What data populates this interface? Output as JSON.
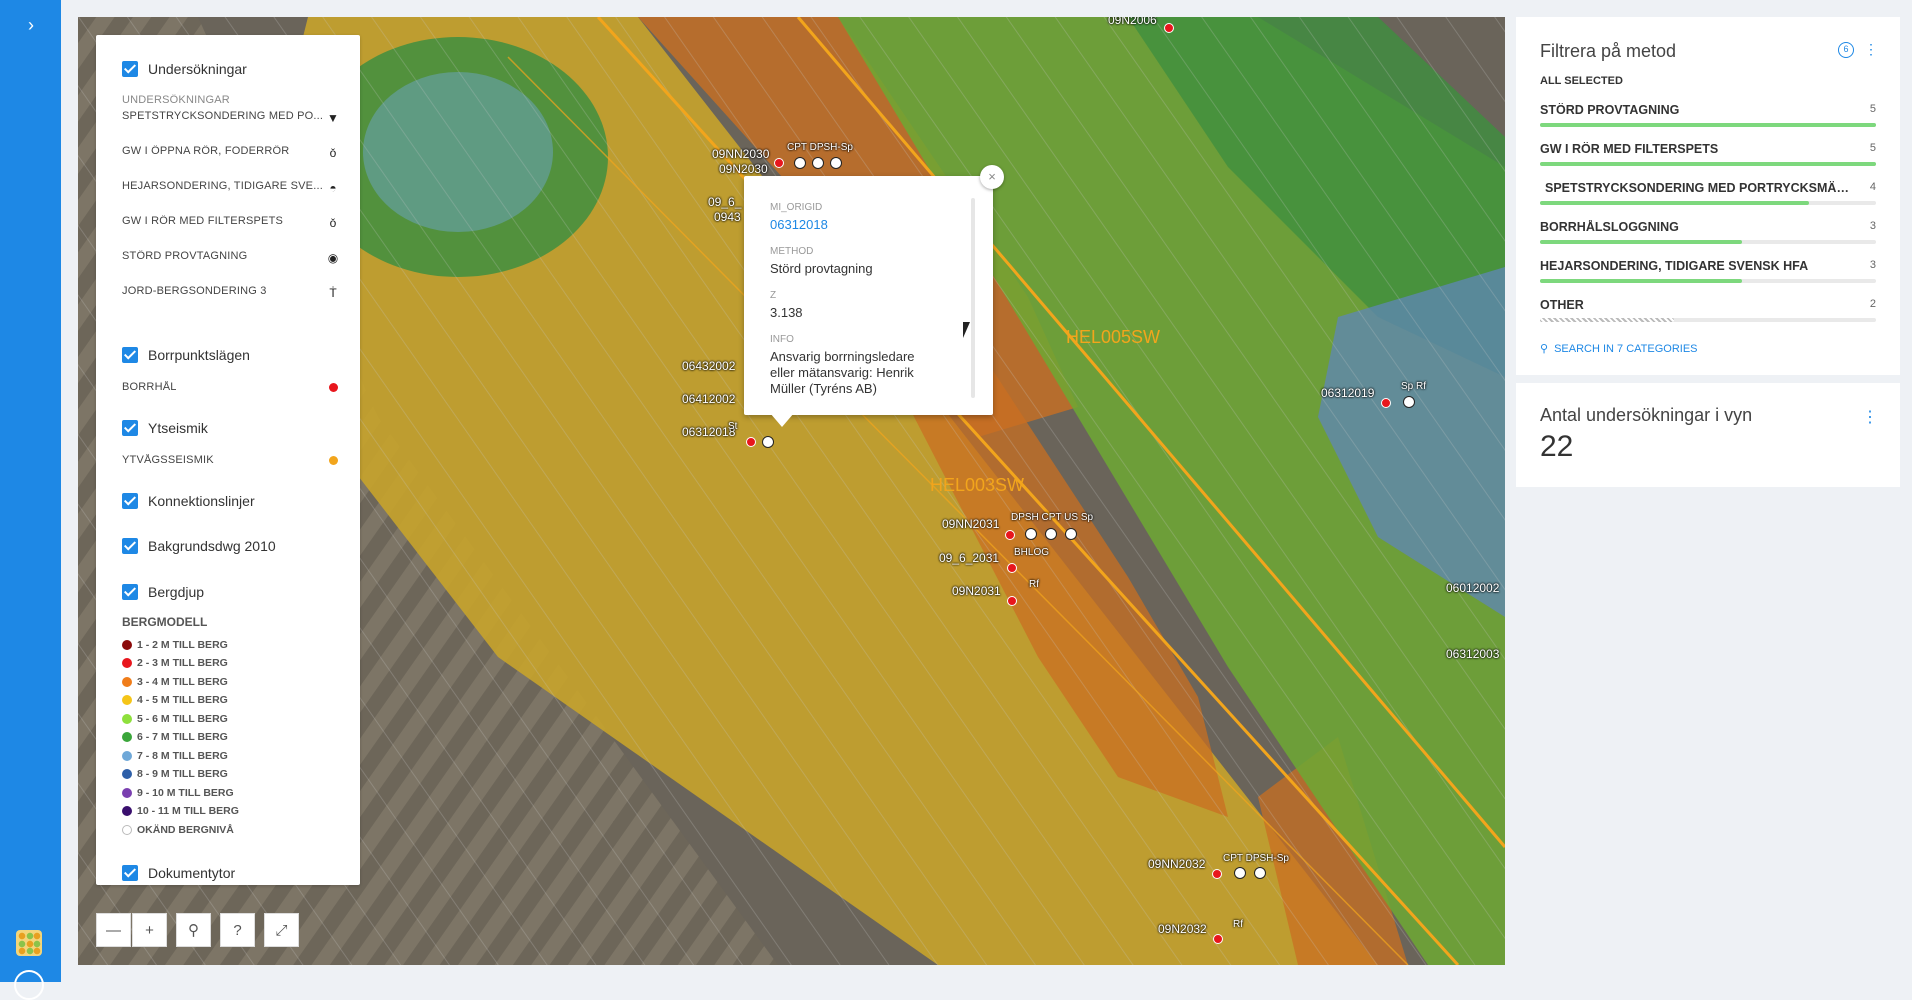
{
  "sidebar": {
    "expand_icon": "chevron-right-icon",
    "app_icon": "app-grid-icon"
  },
  "layers": {
    "undersokningar": {
      "label": "Undersökningar",
      "caption": "UNDERSÖKNINGAR",
      "items": [
        {
          "label": "SPETSTRYCKSONDERING MED PO...",
          "icon": "method-spets-icon"
        },
        {
          "label": "GW I ÖPPNA RÖR, FODERRÖR",
          "icon": "method-gw-open-icon"
        },
        {
          "label": "HEJARSONDERING, TIDIGARE SVE...",
          "icon": "method-hejar-icon"
        },
        {
          "label": "GW I RÖR MED FILTERSPETS",
          "icon": "method-gw-filter-icon"
        },
        {
          "label": "STÖRD PROVTAGNING",
          "icon": "method-stord-icon"
        },
        {
          "label": "JORD-BERGSONDERING 3",
          "icon": "method-jordberg-icon"
        }
      ]
    },
    "borrpunkt": {
      "label": "Borrpunktslägen",
      "items": [
        {
          "label": "BORRHÅL",
          "color": "#e8161d"
        }
      ]
    },
    "ytseismik": {
      "label": "Ytseismik",
      "items": [
        {
          "label": "YTVÅGSSEISMIK",
          "color": "#f2a51c"
        }
      ]
    },
    "konnektion": {
      "label": "Konnektionslinjer"
    },
    "bakgrund": {
      "label": "Bakgrundsdwg 2010"
    },
    "bergdjup": {
      "label": "Bergdjup",
      "caption": "BERGMODELL",
      "legend": [
        {
          "label": "1 - 2 M TILL BERG",
          "color": "#8b0a0a"
        },
        {
          "label": "2 - 3 M TILL BERG",
          "color": "#e8161d"
        },
        {
          "label": "3 - 4 M TILL BERG",
          "color": "#f07d1a"
        },
        {
          "label": "4 - 5 M TILL BERG",
          "color": "#f5c518"
        },
        {
          "label": "5 - 6 M TILL BERG",
          "color": "#8ee03c"
        },
        {
          "label": "6 - 7 M TILL BERG",
          "color": "#3aa63a"
        },
        {
          "label": "7 - 8 M TILL BERG",
          "color": "#6fa8d8"
        },
        {
          "label": "8 - 9 M TILL BERG",
          "color": "#2e5fa8"
        },
        {
          "label": "9 - 10 M TILL BERG",
          "color": "#7a3fb0"
        },
        {
          "label": "10 - 11 M TILL BERG",
          "color": "#3a0f6e"
        },
        {
          "label": "OKÄND BERGNIVÅ",
          "color": "#ffffff"
        }
      ]
    },
    "dokument": {
      "label": "Dokumentytor"
    }
  },
  "zoom": {
    "minus": "—",
    "plus": "+",
    "search_icon": "search-icon",
    "help": "?",
    "fullscreen_icon": "fullscreen-icon"
  },
  "popup": {
    "close": "×",
    "fields": [
      {
        "key": "MI_ORIGID",
        "value": "06312018",
        "link": true
      },
      {
        "key": "METHOD",
        "value": "Störd provtagning"
      },
      {
        "key": "Z",
        "value": "3.138"
      },
      {
        "key": "INFO",
        "value": "Ansvarig borrningsledare eller mätansvarig: Henrik Müller (Tyréns AB)"
      }
    ]
  },
  "map_labels": {
    "hel005sw": "HEL005SW",
    "hel003sw": "HEL003SW",
    "points": [
      {
        "id": "09NN2030",
        "syms": "CPT DPSH-Sp"
      },
      {
        "id": "09N2030"
      },
      {
        "id": "09_6_"
      },
      {
        "id": "0943"
      },
      {
        "id": "06432002"
      },
      {
        "id": "06412002"
      },
      {
        "id": "06312018",
        "syms": "St"
      },
      {
        "id": "09NN2031",
        "syms": "DPSH CPT US Sp"
      },
      {
        "id": "09_6_2031",
        "syms": "BHLOG"
      },
      {
        "id": "09N2031",
        "syms": "Rf"
      },
      {
        "id": "06312019",
        "syms": "Sp Rf"
      },
      {
        "id": "06012002"
      },
      {
        "id": "06312003"
      },
      {
        "id": "09NN2032",
        "syms": "CPT DPSH-Sp"
      },
      {
        "id": "09N2032",
        "syms": "Rf"
      },
      {
        "id": "09N2006"
      }
    ]
  },
  "filter_panel": {
    "title": "Filtrera på metod",
    "all_selected": "ALL SELECTED",
    "rows": [
      {
        "label": "STÖRD PROVTAGNING",
        "count": "5",
        "fraction": 1.0
      },
      {
        "label": "GW I RÖR MED FILTERSPETS",
        "count": "5",
        "fraction": 1.0
      },
      {
        "label": "SPETSTRYCKSONDERING MED PORTRYCKSMÄT...",
        "count": "4",
        "fraction": 0.8
      },
      {
        "label": "BORRHÅLSLOGGNING",
        "count": "3",
        "fraction": 0.6
      },
      {
        "label": "HEJARSONDERING, TIDIGARE SVENSK HFA",
        "count": "3",
        "fraction": 0.6
      },
      {
        "label": "OTHER",
        "count": "2",
        "fraction": 0.4,
        "hatched": true
      }
    ],
    "search": "SEARCH IN 7 CATEGORIES"
  },
  "count_panel": {
    "title": "Antal undersökningar i vyn",
    "value": "22"
  }
}
